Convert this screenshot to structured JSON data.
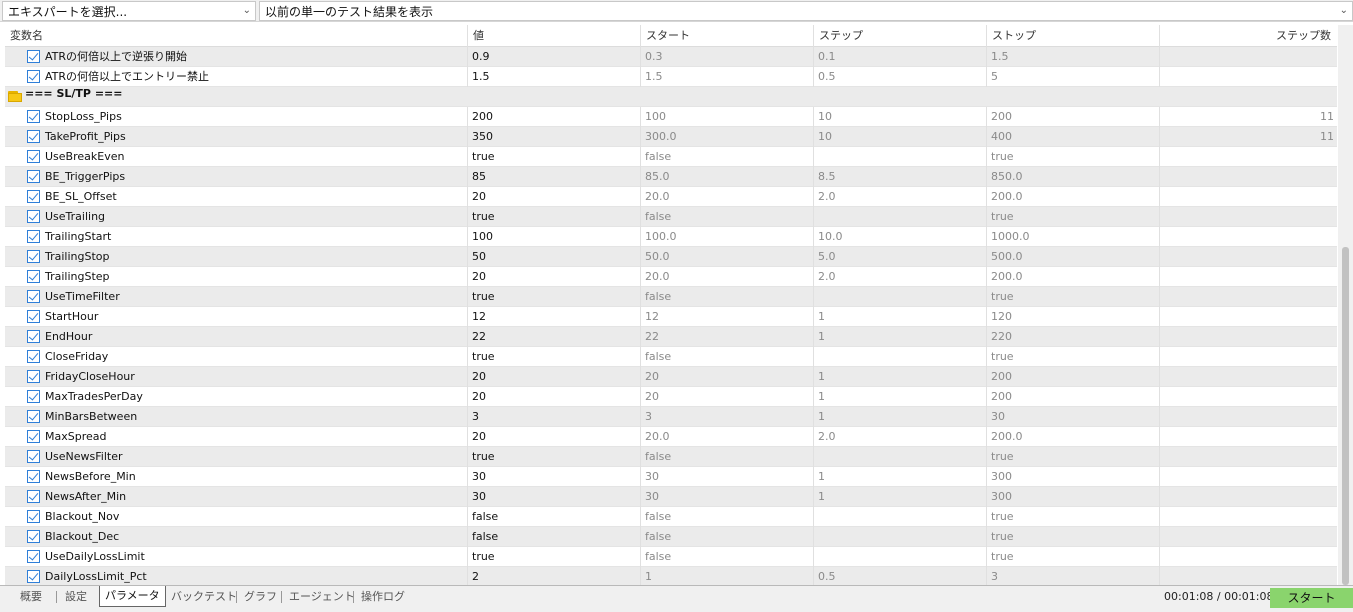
{
  "top": {
    "expert_select": "エキスパートを選択...",
    "result_select": "以前の単一のテスト結果を表示"
  },
  "columns": [
    "変数名",
    "値",
    "スタート",
    "ステップ",
    "ストップ",
    "ステップ数"
  ],
  "rows": [
    {
      "type": "param",
      "name": "ATRの何倍以上で逆張り開始",
      "value": "0.9",
      "start": "0.3",
      "step": "0.1",
      "stop": "1.5",
      "count": ""
    },
    {
      "type": "param",
      "name": "ATRの何倍以上でエントリー禁止",
      "value": "1.5",
      "start": "1.5",
      "step": "0.5",
      "stop": "5",
      "count": ""
    },
    {
      "type": "group",
      "name": "=== SL/TP ==="
    },
    {
      "type": "param",
      "name": "StopLoss_Pips",
      "value": "200",
      "start": "100",
      "step": "10",
      "stop": "200",
      "count": "11"
    },
    {
      "type": "param",
      "name": "TakeProfit_Pips",
      "value": "350",
      "start": "300.0",
      "step": "10",
      "stop": "400",
      "count": "11"
    },
    {
      "type": "param",
      "name": "UseBreakEven",
      "value": "true",
      "start": "false",
      "step": "",
      "stop": "true",
      "count": ""
    },
    {
      "type": "param",
      "name": "BE_TriggerPips",
      "value": "85",
      "start": "85.0",
      "step": "8.5",
      "stop": "850.0",
      "count": ""
    },
    {
      "type": "param",
      "name": "BE_SL_Offset",
      "value": "20",
      "start": "20.0",
      "step": "2.0",
      "stop": "200.0",
      "count": ""
    },
    {
      "type": "param",
      "name": "UseTrailing",
      "value": "true",
      "start": "false",
      "step": "",
      "stop": "true",
      "count": ""
    },
    {
      "type": "param",
      "name": "TrailingStart",
      "value": "100",
      "start": "100.0",
      "step": "10.0",
      "stop": "1000.0",
      "count": ""
    },
    {
      "type": "param",
      "name": "TrailingStop",
      "value": "50",
      "start": "50.0",
      "step": "5.0",
      "stop": "500.0",
      "count": ""
    },
    {
      "type": "param",
      "name": "TrailingStep",
      "value": "20",
      "start": "20.0",
      "step": "2.0",
      "stop": "200.0",
      "count": ""
    },
    {
      "type": "param",
      "name": "UseTimeFilter",
      "value": "true",
      "start": "false",
      "step": "",
      "stop": "true",
      "count": ""
    },
    {
      "type": "param",
      "name": "StartHour",
      "value": "12",
      "start": "12",
      "step": "1",
      "stop": "120",
      "count": ""
    },
    {
      "type": "param",
      "name": "EndHour",
      "value": "22",
      "start": "22",
      "step": "1",
      "stop": "220",
      "count": ""
    },
    {
      "type": "param",
      "name": "CloseFriday",
      "value": "true",
      "start": "false",
      "step": "",
      "stop": "true",
      "count": ""
    },
    {
      "type": "param",
      "name": "FridayCloseHour",
      "value": "20",
      "start": "20",
      "step": "1",
      "stop": "200",
      "count": ""
    },
    {
      "type": "param",
      "name": "MaxTradesPerDay",
      "value": "20",
      "start": "20",
      "step": "1",
      "stop": "200",
      "count": ""
    },
    {
      "type": "param",
      "name": "MinBarsBetween",
      "value": "3",
      "start": "3",
      "step": "1",
      "stop": "30",
      "count": ""
    },
    {
      "type": "param",
      "name": "MaxSpread",
      "value": "20",
      "start": "20.0",
      "step": "2.0",
      "stop": "200.0",
      "count": ""
    },
    {
      "type": "param",
      "name": "UseNewsFilter",
      "value": "true",
      "start": "false",
      "step": "",
      "stop": "true",
      "count": ""
    },
    {
      "type": "param",
      "name": "NewsBefore_Min",
      "value": "30",
      "start": "30",
      "step": "1",
      "stop": "300",
      "count": ""
    },
    {
      "type": "param",
      "name": "NewsAfter_Min",
      "value": "30",
      "start": "30",
      "step": "1",
      "stop": "300",
      "count": ""
    },
    {
      "type": "param",
      "name": "Blackout_Nov",
      "value": "false",
      "start": "false",
      "step": "",
      "stop": "true",
      "count": ""
    },
    {
      "type": "param",
      "name": "Blackout_Dec",
      "value": "false",
      "start": "false",
      "step": "",
      "stop": "true",
      "count": ""
    },
    {
      "type": "param",
      "name": "UseDailyLossLimit",
      "value": "true",
      "start": "false",
      "step": "",
      "stop": "true",
      "count": ""
    },
    {
      "type": "param",
      "name": "DailyLossLimit_Pct",
      "value": "2",
      "start": "1",
      "step": "0.5",
      "stop": "3",
      "count": ""
    }
  ],
  "tabs": [
    "概要",
    "設定",
    "パラメータ",
    "バックテスト",
    "グラフ",
    "エージェント",
    "操作ログ"
  ],
  "active_tab": "パラメータ",
  "status": {
    "timer": "00:01:08 / 00:01:08",
    "start_button": "スタート"
  },
  "colors": {
    "checkbox": "#2f7fd8",
    "start_button_bg": "#8ad46d",
    "folder": "#f7c816",
    "row_alt": "#ebebeb"
  }
}
